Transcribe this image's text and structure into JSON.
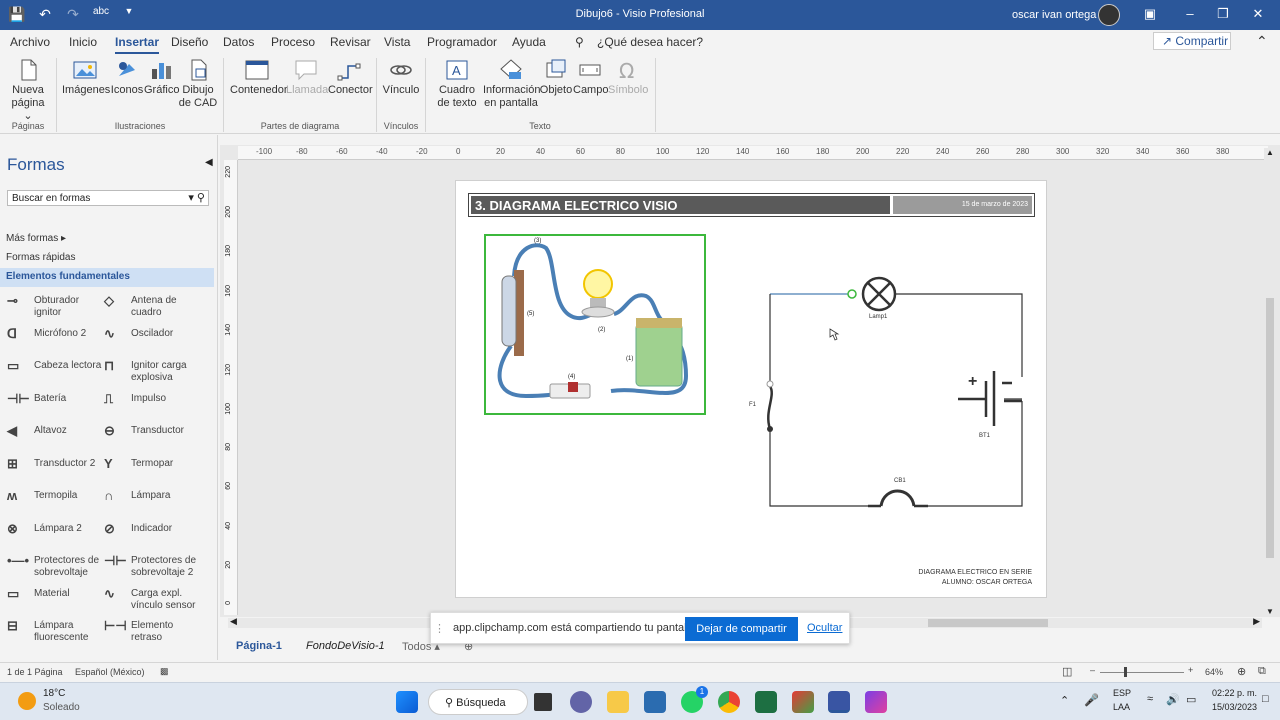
{
  "title_bar": {
    "doc_title": "Dibujo6  -  Visio Profesional",
    "user": "oscar ivan ortega"
  },
  "menu": {
    "items": [
      "Archivo",
      "Inicio",
      "Insertar",
      "Diseño",
      "Datos",
      "Proceso",
      "Revisar",
      "Vista",
      "Programador",
      "Ayuda"
    ],
    "active": "Insertar",
    "tell_me": "¿Qué desea hacer?",
    "share": "Compartir"
  },
  "ribbon": {
    "nueva_pagina": "Nueva página",
    "imagenes": "Imágenes",
    "iconos": "Iconos",
    "grafico": "Gráfico",
    "dibujo_cad": "Dibujo de CAD",
    "contenedor": "Contenedor",
    "llamada": "Llamada",
    "conector": "Conector",
    "vinculo": "Vínculo",
    "cuadro_texto": "Cuadro de texto",
    "info_pantalla": "Información en pantalla",
    "objeto": "Objeto",
    "campo": "Campo",
    "simbolo": "Símbolo",
    "groups": {
      "paginas": "Páginas",
      "ilustraciones": "Ilustraciones",
      "partes": "Partes de diagrama",
      "vinculos": "Vínculos",
      "texto": "Texto"
    }
  },
  "shapes_panel": {
    "title": "Formas",
    "search_placeholder": "Buscar en formas",
    "mas_formas": "Más formas",
    "formas_rapidas": "Formas rápidas",
    "elementos": "Elementos fundamentales",
    "items": [
      "Obturador ignitor",
      "Antena de cuadro",
      "Micrófono 2",
      "Oscilador",
      "Cabeza lectora",
      "Ignitor carga explosiva",
      "Batería",
      "Impulso",
      "Altavoz",
      "Transductor",
      "Transductor 2",
      "Termopar",
      "Termopila",
      "Lámpara",
      "Lámpara 2",
      "Indicador",
      "Protectores de sobrevoltaje",
      "Protectores de sobrevoltaje 2",
      "Material",
      "Carga expl. vínculo sensor",
      "Lámpara fluorescente",
      "Elemento retraso"
    ]
  },
  "ruler_labels": [
    "-100",
    "-80",
    "-60",
    "-40",
    "-20",
    "0",
    "20",
    "40",
    "60",
    "80",
    "100",
    "120",
    "140",
    "160",
    "180",
    "200",
    "220",
    "240",
    "260",
    "280",
    "300",
    "320",
    "340",
    "360",
    "380"
  ],
  "vruler_labels": [
    "220",
    "200",
    "180",
    "160",
    "140",
    "120",
    "100",
    "80",
    "60",
    "40",
    "20",
    "0"
  ],
  "drawing": {
    "title": "3. DIAGRAMA ELECTRICO VISIO",
    "date": "15 de marzo de 2023",
    "labels": {
      "lamp": "Lamp1",
      "battery": "BT1",
      "fuse": "F1",
      "switch": "CB1",
      "photo_1": "(1)",
      "photo_2": "(2)",
      "photo_3": "(3)",
      "photo_4": "(4)",
      "photo_5": "(5)"
    },
    "footer_line1": "DIAGRAMA ELECTRICO EN SERIE",
    "footer_line2": "ALUMNO: OSCAR ORTEGA"
  },
  "page_tabs": {
    "page1": "Página-1",
    "background": "FondoDeVisio-1",
    "all": "Todos"
  },
  "share_bar": {
    "message": "app.clipchamp.com está compartiendo tu pantalla.",
    "stop": "Dejar de compartir",
    "hide": "Ocultar"
  },
  "status_bar": {
    "page_info": "1 de 1 Página",
    "language": "Español (México)",
    "zoom": "64%"
  },
  "taskbar": {
    "weather_temp": "18°C",
    "weather_desc": "Soleado",
    "search": "Búsqueda",
    "lang1": "ESP",
    "lang2": "LAA",
    "time": "02:22 p. m.",
    "date": "15/03/2023",
    "whatsapp_badge": "1"
  }
}
